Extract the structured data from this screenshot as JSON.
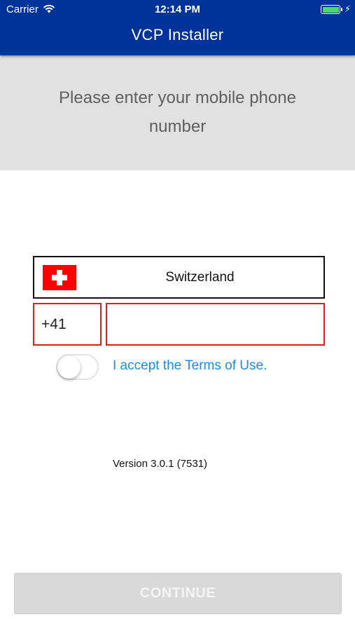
{
  "status_bar": {
    "carrier": "Carrier",
    "time": "12:14 PM",
    "wifi_icon": "wifi-icon",
    "battery_icon": "battery-icon",
    "charging_icon": "charging-bolt-icon",
    "battery_color": "#4cd964"
  },
  "nav": {
    "title": "VCP Installer",
    "background_color": "#003399"
  },
  "prompt": {
    "text": "Please enter your mobile phone number"
  },
  "form": {
    "country": {
      "name": "Switzerland",
      "flag_icon": "swiss-flag-icon"
    },
    "dial_code": "+41",
    "phone_number": {
      "value": "",
      "placeholder": ""
    },
    "terms": {
      "toggle_on": false,
      "label": "I accept the Terms of Use."
    },
    "field_error_color": "#e31b1b"
  },
  "footer": {
    "version": "Version 3.0.1 (7531)",
    "continue_label": "CONTINUE",
    "continue_enabled": false
  }
}
